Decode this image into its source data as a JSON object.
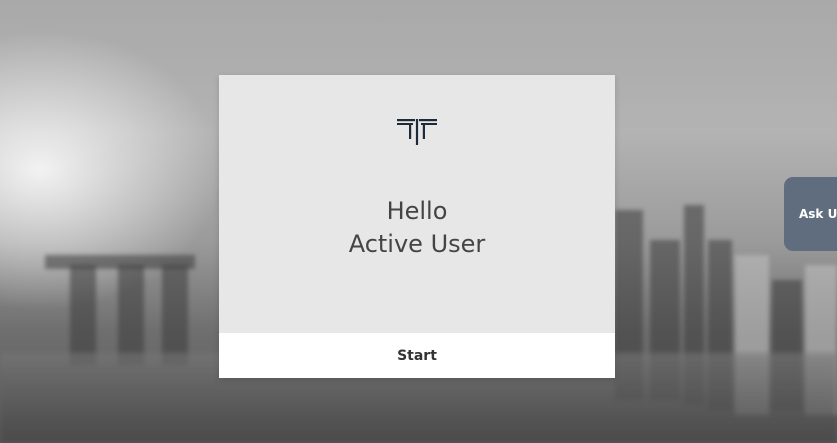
{
  "card": {
    "logo_icon": "tt-monogram-icon",
    "greeting_line1": "Hello",
    "greeting_line2": "Active User",
    "start_label": "Start"
  },
  "side_tab": {
    "label": "Ask Us"
  },
  "colors": {
    "card_bg": "#e7e7e7",
    "logo": "#1c2a3a",
    "side_tab_bg": "#5f6d7e"
  }
}
